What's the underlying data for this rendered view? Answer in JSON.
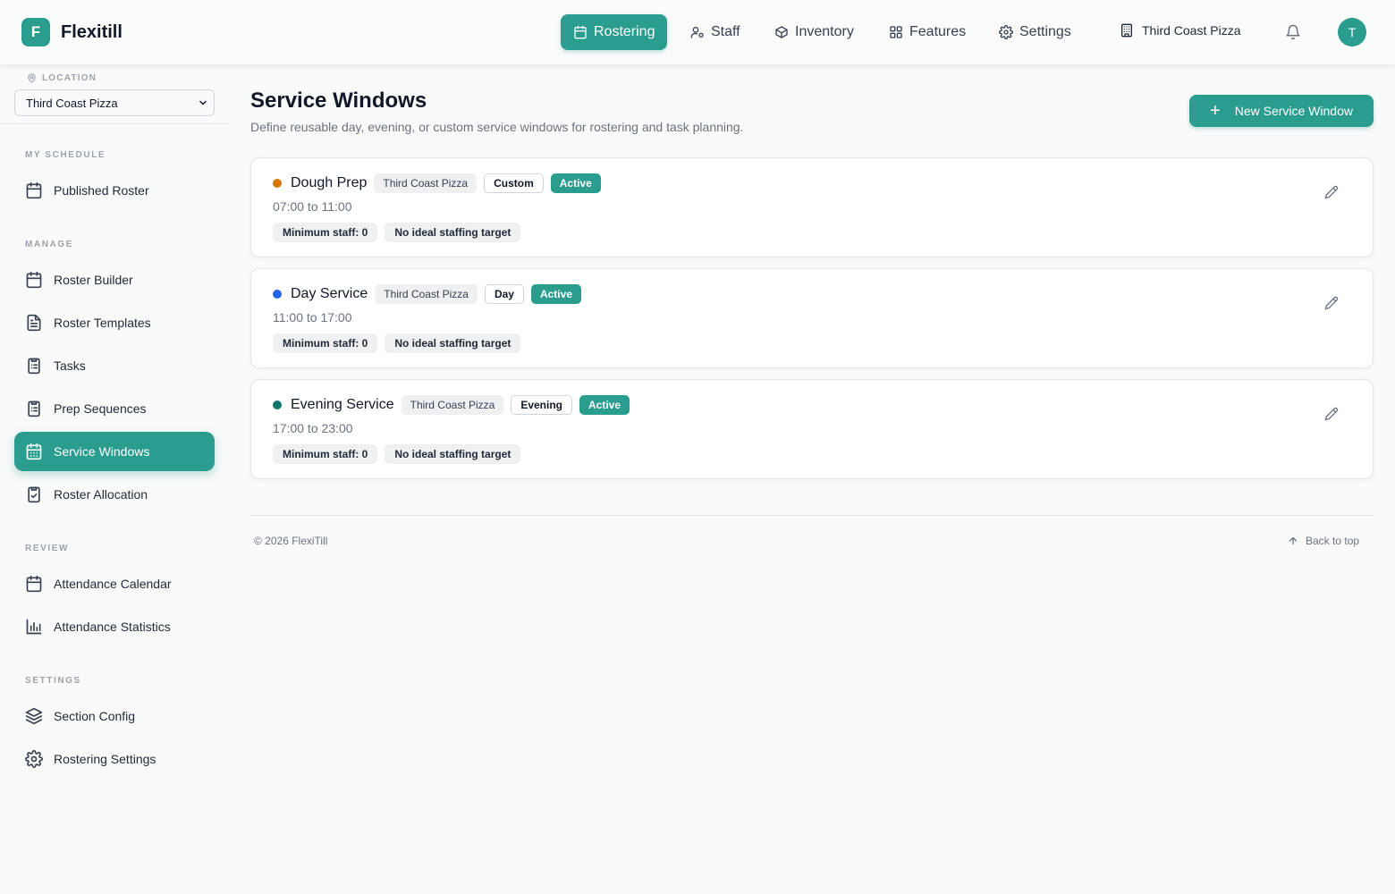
{
  "brand": {
    "logo_letter": "F",
    "name": "Flexitill"
  },
  "topnav": {
    "items": [
      {
        "label": "Rostering",
        "icon": "calendar-icon"
      },
      {
        "label": "Staff",
        "icon": "user-cog-icon"
      },
      {
        "label": "Inventory",
        "icon": "package-icon"
      },
      {
        "label": "Features",
        "icon": "grid-icon"
      },
      {
        "label": "Settings",
        "icon": "gear-icon"
      }
    ],
    "active": "Rostering",
    "location": "Third Coast Pizza",
    "avatar": "T"
  },
  "sidebar": {
    "location_label": "LOCATION",
    "location_value": "Third Coast Pizza",
    "sections": [
      {
        "title": "MY SCHEDULE",
        "items": [
          {
            "label": "Published Roster",
            "icon": "calendar-icon"
          }
        ]
      },
      {
        "title": "MANAGE",
        "items": [
          {
            "label": "Roster Builder",
            "icon": "calendar-icon"
          },
          {
            "label": "Roster Templates",
            "icon": "file-icon"
          },
          {
            "label": "Tasks",
            "icon": "clipboard-list-icon"
          },
          {
            "label": "Prep Sequences",
            "icon": "clipboard-list-icon"
          },
          {
            "label": "Service Windows",
            "icon": "calendar-grid-icon"
          },
          {
            "label": "Roster Allocation",
            "icon": "clipboard-check-icon"
          }
        ]
      },
      {
        "title": "REVIEW",
        "items": [
          {
            "label": "Attendance Calendar",
            "icon": "calendar-icon"
          },
          {
            "label": "Attendance Statistics",
            "icon": "bar-chart-icon"
          }
        ]
      },
      {
        "title": "SETTINGS",
        "items": [
          {
            "label": "Section Config",
            "icon": "layers-icon"
          },
          {
            "label": "Rostering Settings",
            "icon": "gear-icon"
          }
        ]
      }
    ],
    "active": "Service Windows"
  },
  "main": {
    "title": "Service Windows",
    "subtitle": "Define reusable day, evening, or custom service windows for rostering and task planning.",
    "new_button": "New Service Window",
    "windows": [
      {
        "name": "Dough Prep",
        "color": "#d97706",
        "location": "Third Coast Pizza",
        "type": "Custom",
        "status": "Active",
        "time": "07:00 to 11:00",
        "min_staff": "Minimum staff: 0",
        "ideal": "No ideal staffing target"
      },
      {
        "name": "Day Service",
        "color": "#2563eb",
        "location": "Third Coast Pizza",
        "type": "Day",
        "status": "Active",
        "time": "11:00 to 17:00",
        "min_staff": "Minimum staff: 0",
        "ideal": "No ideal staffing target"
      },
      {
        "name": "Evening Service",
        "color": "#0f766e",
        "location": "Third Coast Pizza",
        "type": "Evening",
        "status": "Active",
        "time": "17:00 to 23:00",
        "min_staff": "Minimum staff: 0",
        "ideal": "No ideal staffing target"
      }
    ]
  },
  "footer": {
    "copyright": "© 2026 FlexiTill",
    "back_to_top": "Back to top"
  },
  "colors": {
    "accent": "#2a9d8f"
  }
}
